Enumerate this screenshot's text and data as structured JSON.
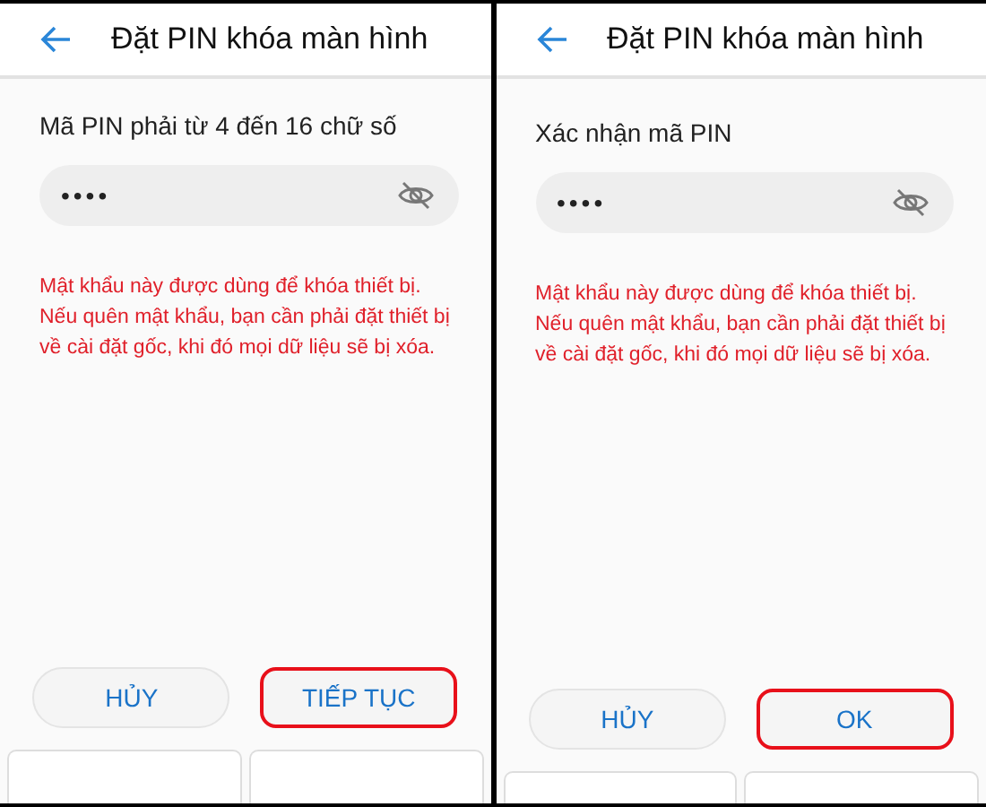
{
  "screens": [
    {
      "title": "Đặt PIN khóa màn hình",
      "label": "Mã PIN phải từ 4 đến 16 chữ số",
      "pin": "••••",
      "warning": "Mật khẩu này được dùng để khóa thiết bị. Nếu quên mật khẩu, bạn cần phải đặt thiết bị về cài đặt gốc, khi đó mọi dữ liệu sẽ bị xóa.",
      "buttons": [
        {
          "label": "HỦY",
          "highlighted": false
        },
        {
          "label": "TIẾP TỤC",
          "highlighted": true
        }
      ]
    },
    {
      "title": "Đặt PIN khóa màn hình",
      "label": "Xác nhận mã PIN",
      "pin": "••••",
      "warning": "Mật khẩu này được dùng để khóa thiết bị. Nếu quên mật khẩu, bạn cần phải đặt thiết bị về cài đặt gốc, khi đó mọi dữ liệu sẽ bị xóa.",
      "buttons": [
        {
          "label": "HỦY",
          "highlighted": false
        },
        {
          "label": "OK",
          "highlighted": true
        }
      ]
    }
  ]
}
